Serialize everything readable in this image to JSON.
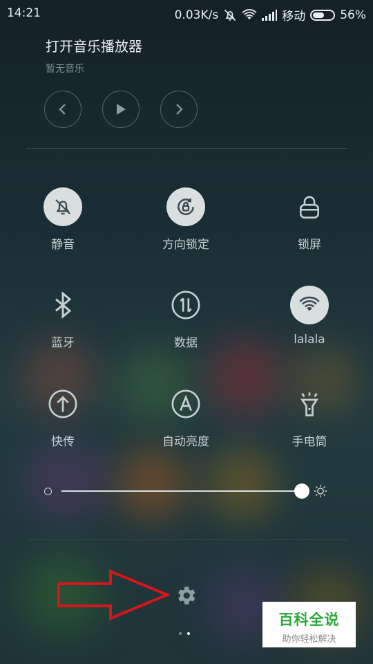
{
  "status_bar": {
    "time": "14:21",
    "speed": "0.03K/s",
    "carrier": "移动",
    "battery": "56%",
    "battery_level": 0.56,
    "icons": [
      "bell-off-icon",
      "wifi-icon",
      "signal-icon",
      "battery-icon"
    ]
  },
  "music": {
    "title": "打开音乐播放器",
    "subtitle": "暂无音乐",
    "controls": [
      "previous-icon",
      "play-icon",
      "next-icon"
    ]
  },
  "toggles": [
    {
      "label": "静音",
      "icon": "bell-off-icon",
      "active": true
    },
    {
      "label": "方向锁定",
      "icon": "rotation-lock-icon",
      "active": true
    },
    {
      "label": "锁屏",
      "icon": "lock-icon",
      "active": false
    },
    {
      "label": "蓝牙",
      "icon": "bluetooth-icon",
      "active": false
    },
    {
      "label": "数据",
      "icon": "mobile-data-icon",
      "active": false
    },
    {
      "label": "lalala",
      "icon": "wifi-icon",
      "active": true
    },
    {
      "label": "快传",
      "icon": "quick-transfer-icon",
      "active": false
    },
    {
      "label": "自动亮度",
      "icon": "auto-brightness-icon",
      "active": false
    },
    {
      "label": "手电筒",
      "icon": "flashlight-icon",
      "active": false
    }
  ],
  "brightness": {
    "level": 1.0,
    "low_icon": "brightness-low-icon",
    "high_icon": "brightness-high-icon"
  },
  "settings": {
    "icon": "gear-icon",
    "annotation": "red-arrow-icon"
  },
  "pager": {
    "count": 2,
    "active": 2
  },
  "watermark": {
    "title": "百科全说",
    "subtitle": "助你轻松解决"
  },
  "colors": {
    "background": "#1c2f36",
    "active_toggle": "#d9dedf",
    "arrow": "#d8141c",
    "watermark_green": "#2aa83a"
  }
}
